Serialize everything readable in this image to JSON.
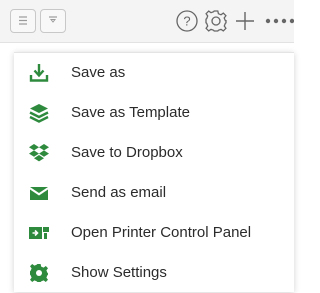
{
  "toolbar": {
    "buttons": [
      {
        "icon": "list-icon"
      },
      {
        "icon": "filter-icon"
      }
    ],
    "icons": [
      "help-icon",
      "gear-icon",
      "plus-icon",
      "more-icon"
    ],
    "icon_color": "#666666"
  },
  "menu": {
    "accent": "#2e8b3e",
    "items": [
      {
        "label": "Save as",
        "icon": "download-icon"
      },
      {
        "label": "Save as Template",
        "icon": "layers-icon"
      },
      {
        "label": "Save to Dropbox",
        "icon": "dropbox-icon"
      },
      {
        "label": "Send as email",
        "icon": "envelope-icon"
      },
      {
        "label": "Open Printer Control Panel",
        "icon": "printer-panel-icon"
      },
      {
        "label": "Show Settings",
        "icon": "settings-icon"
      }
    ]
  }
}
